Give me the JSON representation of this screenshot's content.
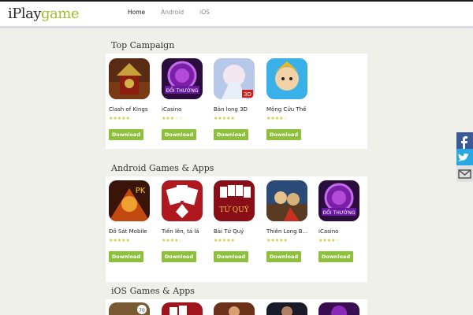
{
  "brand": {
    "logo_part1": "iPl",
    "logo_part2": "ay",
    "logo_part3": "game"
  },
  "nav": {
    "items": [
      {
        "label": "Home"
      },
      {
        "label": "Android"
      },
      {
        "label": "iOS"
      }
    ]
  },
  "sections": [
    {
      "title": "Top Campaign",
      "games": [
        {
          "name": "Clash of Kings",
          "rating": 5,
          "download": "Download"
        },
        {
          "name": "iCasino",
          "rating": 3,
          "download": "Download"
        },
        {
          "name": "Bàn long 3D",
          "rating": 5,
          "download": "Download"
        },
        {
          "name": "Mộng Cửu Thế",
          "rating": 4,
          "download": "Download"
        }
      ]
    },
    {
      "title": "Android Games & Apps",
      "games": [
        {
          "name": "Đồ Sát Mobile",
          "rating": 5,
          "download": "Download"
        },
        {
          "name": "Tiến lên, tá lả",
          "rating": 4,
          "download": "Download"
        },
        {
          "name": "Bài Tứ Quý",
          "rating": 5,
          "download": "Download"
        },
        {
          "name": "Thiên Long B...",
          "rating": 5,
          "download": "Download"
        },
        {
          "name": "iCasino",
          "rating": 4,
          "download": "Download"
        }
      ]
    },
    {
      "title": "iOS Games & Apps"
    }
  ],
  "icon_text": {
    "casino_badge": "ĐỔI THƯỞNG",
    "banlong_badge": "3D",
    "dosat_badge": "PK",
    "tuquy_badge": "TỨ QUÝ",
    "ios1_badge": "70"
  },
  "colors": {
    "download_button": "#8ec13b",
    "logo_green": "#9ec12e",
    "facebook": "#3b5998",
    "twitter": "#29a9e1",
    "page_bg": "#f0f0ea"
  },
  "social_icons": [
    "facebook-icon",
    "twitter-icon",
    "email-icon"
  ]
}
